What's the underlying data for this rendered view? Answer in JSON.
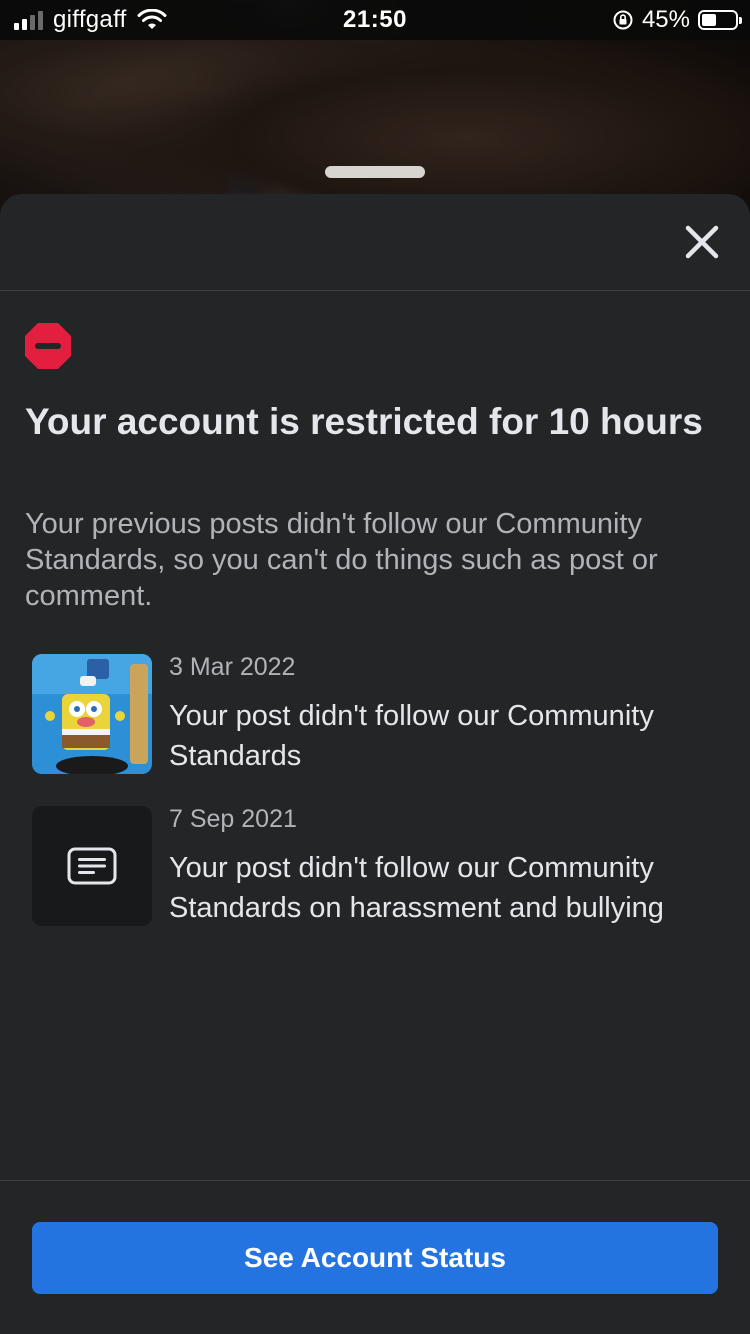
{
  "status_bar": {
    "carrier": "giffgaff",
    "time": "21:50",
    "battery_percent": "45%",
    "battery_level": 0.45
  },
  "sheet": {
    "close_icon": "close-icon",
    "alert_icon": "stop-sign-icon",
    "alert_color": "#e41e3f",
    "title": "Your account is restricted for 10 hours",
    "description": "Your previous posts didn't follow our Community Standards, so you can't do things such as post or comment.",
    "violations": [
      {
        "thumbnail": "spongebob-image",
        "date": "3 Mar 2022",
        "message": "Your post didn't follow our Community Standards"
      },
      {
        "thumbnail": "text-post-icon",
        "date": "7 Sep 2021",
        "message": "Your post didn't follow our Community Standards on harassment and bullying"
      }
    ],
    "primary_button": "See Account Status",
    "accent_color": "#2374e1"
  }
}
